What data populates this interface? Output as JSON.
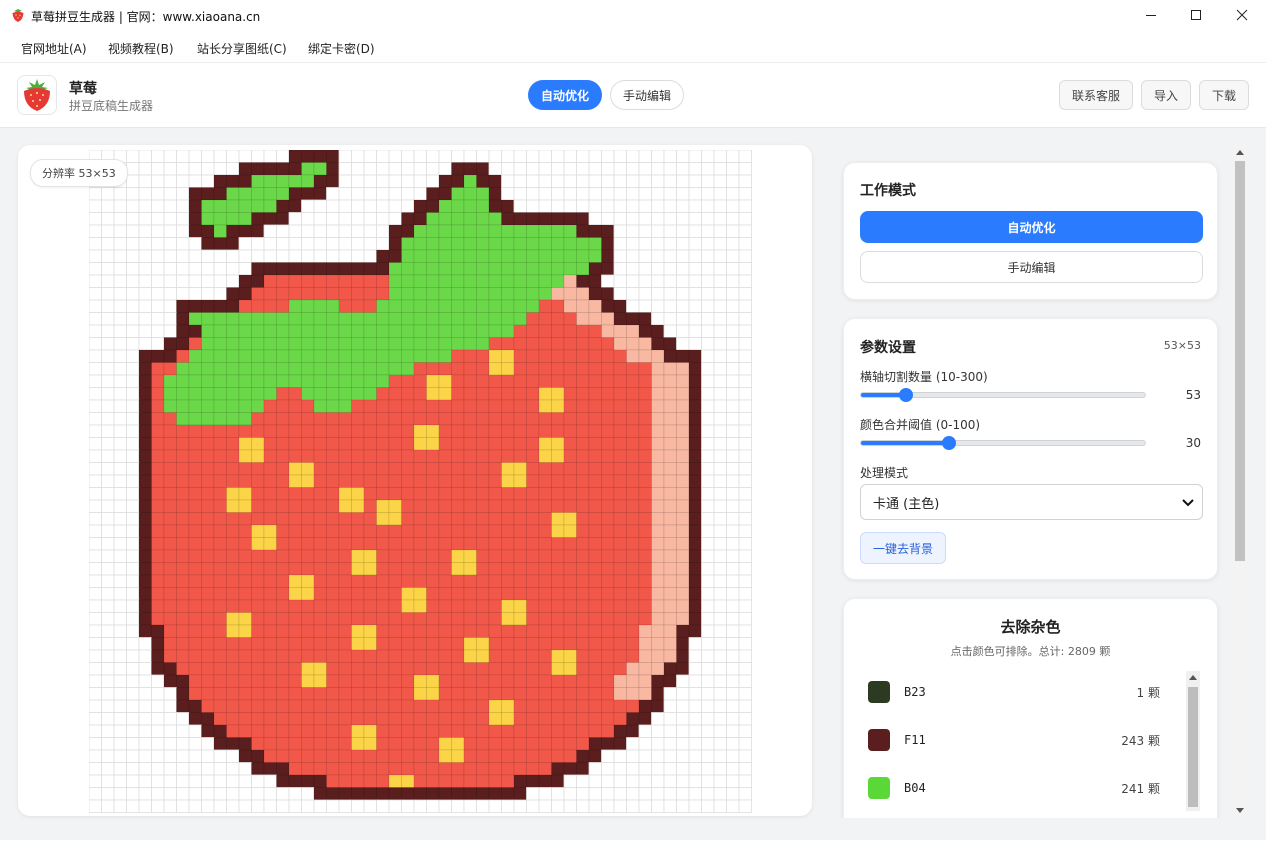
{
  "window": {
    "title": "草莓拼豆生成器 | 官网：www.xiaoana.cn"
  },
  "menu": [
    {
      "label": "官网地址(A)"
    },
    {
      "label": "视频教程(B)"
    },
    {
      "label": "站长分享图纸(C)"
    },
    {
      "label": "绑定卡密(D)"
    }
  ],
  "header": {
    "app_name": "草莓",
    "app_subtitle": "拼豆底稿生成器",
    "tabs": [
      {
        "label": "自动优化"
      },
      {
        "label": "手动编辑"
      }
    ],
    "buttons": [
      {
        "label": "联系客服"
      },
      {
        "label": "导入"
      },
      {
        "label": "下载"
      }
    ]
  },
  "canvas": {
    "resolution_label": "分辨率 53×53"
  },
  "work_mode": {
    "title": "工作模式",
    "auto_label": "自动优化",
    "manual_label": "手动编辑"
  },
  "params": {
    "title": "参数设置",
    "size": "53×53",
    "slider1": {
      "label": "横轴切割数量 (10-300)",
      "value": "53",
      "fraction": 0.16
    },
    "slider2": {
      "label": "颜色合并阈值 (0-100)",
      "value": "30",
      "fraction": 0.31
    },
    "mode_label": "处理模式",
    "mode_value": "卡通 (主色)",
    "bg_button": "一键去背景"
  },
  "noise": {
    "title": "去除杂色",
    "subtitle": "点击颜色可排除。总计: 2809 颗",
    "colors": [
      {
        "code": "B23",
        "count": "1 颗",
        "hex": "#2d3a22"
      },
      {
        "code": "F11",
        "count": "243 颗",
        "hex": "#5a1e1e"
      },
      {
        "code": "B04",
        "count": "241 颗",
        "hex": "#5ad838"
      }
    ]
  },
  "colors": {
    "accent": "#2b7bff",
    "outline": "#5a1e1e",
    "leaf": "#6ad848",
    "berry": "#f2584a",
    "seed": "#fbd448",
    "highlight": "#f8b8a2"
  }
}
